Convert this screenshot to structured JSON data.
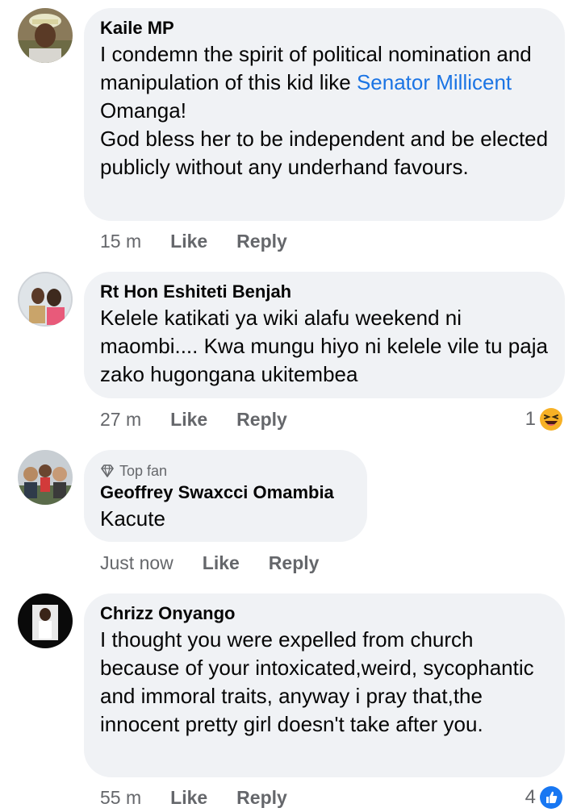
{
  "comments": [
    {
      "author": "Kaile MP",
      "text_before": "I condemn the spirit of political nomination and manipulation of this kid like ",
      "mention": "Senator Millicent",
      "text_after": " Omanga!",
      "text_line2": "God bless her to be independent and be elected publicly without any underhand favours.",
      "time": "15 m",
      "like": "Like",
      "reply": "Reply"
    },
    {
      "author": "Rt Hon Eshiteti Benjah",
      "text": "Kelele katikati ya wiki alafu weekend ni maombi.... Kwa mungu hiyo ni kelele vile tu paja zako hugongana ukitembea",
      "time": "27 m",
      "like": "Like",
      "reply": "Reply",
      "reaction_count": "1",
      "reaction_icon": "haha-emoji-icon"
    },
    {
      "badge": "Top fan",
      "badge_icon": "diamond-icon",
      "author": "Geoffrey Swaxcci Omambia",
      "text": "Kacute",
      "time": "Just now",
      "like": "Like",
      "reply": "Reply"
    },
    {
      "author": "Chrizz Onyango",
      "text": "I thought you were expelled from church because of your intoxicated,weird, sycophantic and immoral traits, anyway i pray that,the innocent pretty girl doesn't take after you.",
      "time": "55 m",
      "like": "Like",
      "reply": "Reply",
      "reaction_count": "4",
      "reaction_icon": "thumbs-up-icon"
    }
  ],
  "colors": {
    "bubble": "#f0f2f5",
    "mention": "#1b74e4",
    "meta": "#65676b",
    "text": "#050505"
  }
}
